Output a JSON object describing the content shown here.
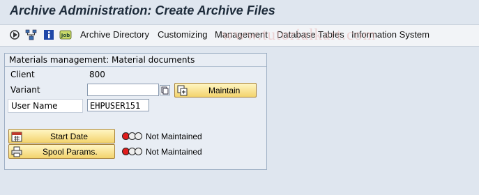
{
  "window": {
    "title": "Archive Administration: Create Archive Files"
  },
  "toolbar": {
    "icons": [
      "execute-icon",
      "hierarchy-icon",
      "info-icon",
      "job-icon"
    ],
    "job_icon_text": "Job",
    "menu": [
      "Archive Directory",
      "Customizing",
      "Management",
      "Database Tables",
      "Information System"
    ]
  },
  "watermark": "www.tutorialkart.com",
  "group": {
    "title": "Materials management: Material documents",
    "client_label": "Client",
    "client_value": "800",
    "variant_label": "Variant",
    "variant_value": "",
    "maintain_label": "Maintain",
    "user_label": "User Name",
    "user_value": "EHPUSER151",
    "start_date_label": "Start Date",
    "start_date_status": "Not Maintained",
    "spool_label": "Spool Params.",
    "spool_status": "Not Maintained"
  }
}
